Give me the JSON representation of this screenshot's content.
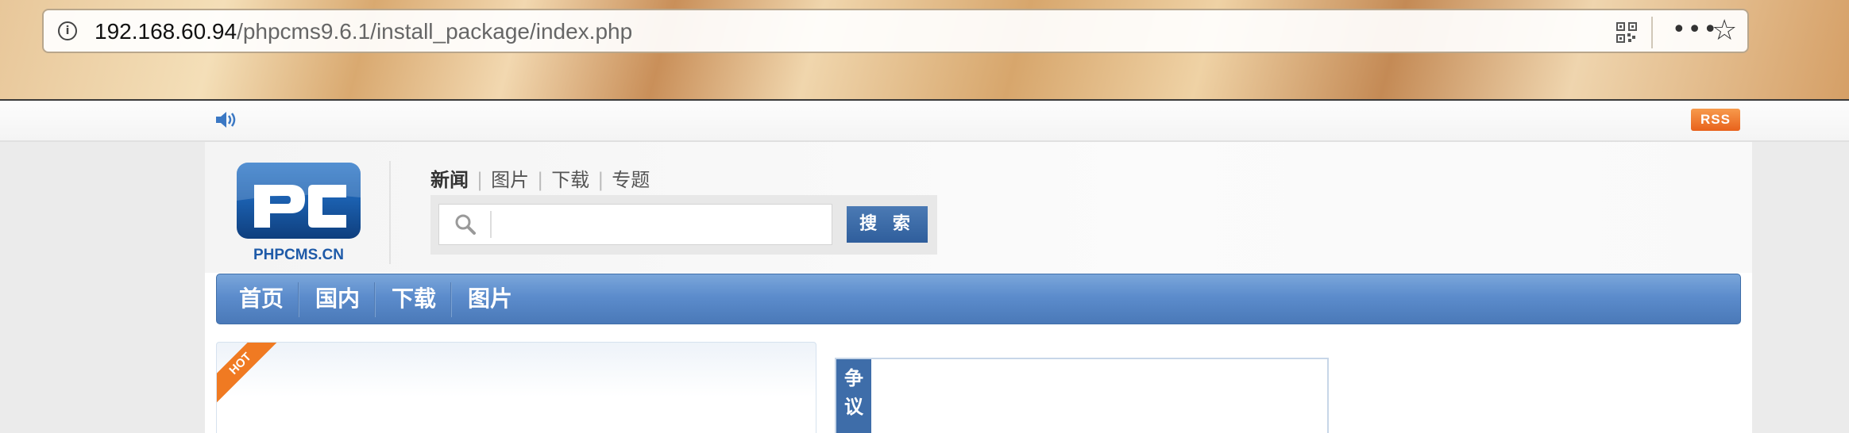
{
  "browser": {
    "url_host": "192.168.60.94",
    "url_path": "/phpcms9.6.1/install_package/index.php"
  },
  "topbar": {
    "rss_label": "RSS"
  },
  "header": {
    "logo_text": "PHPCMS.CN",
    "channels": [
      {
        "label": "新闻",
        "active": true
      },
      {
        "label": "图片",
        "active": false
      },
      {
        "label": "下载",
        "active": false
      },
      {
        "label": "专题",
        "active": false
      }
    ],
    "search": {
      "value": "",
      "button_label": "搜 索"
    }
  },
  "nav": {
    "items": [
      "首页",
      "国内",
      "下载",
      "图片"
    ]
  },
  "content": {
    "hot_badge": "HOT",
    "dispute_tab": "争议"
  },
  "colors": {
    "nav_blue": "#5c8ccc",
    "search_button": "#3a6aa8",
    "rss_orange": "#f07a22"
  }
}
